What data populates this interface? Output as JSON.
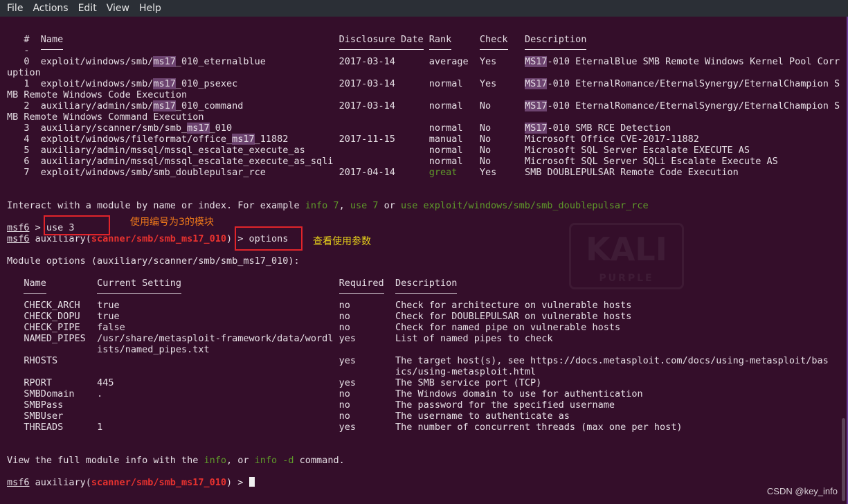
{
  "menu": [
    "File",
    "Actions",
    "Edit",
    "View",
    "Help"
  ],
  "modules": {
    "headers": {
      "num": "#",
      "name": "Name",
      "date": "Disclosure Date",
      "rank": "Rank",
      "check": "Check",
      "desc": "Description"
    },
    "rows": [
      {
        "num": "0",
        "name": "exploit/windows/smb/ms17_010_eternalblue",
        "date": "2017-03-14",
        "rank": "average",
        "check": "Yes",
        "desc": "MS17-010 EternalBlue SMB Remote Windows Kernel Pool Corruption"
      },
      {
        "num": "1",
        "name": "exploit/windows/smb/ms17_010_psexec",
        "date": "2017-03-14",
        "rank": "normal",
        "check": "Yes",
        "desc": "MS17-010 EternalRomance/EternalSynergy/EternalChampion SMB Remote Windows Code Execution"
      },
      {
        "num": "2",
        "name": "auxiliary/admin/smb/ms17_010_command",
        "date": "2017-03-14",
        "rank": "normal",
        "check": "No",
        "desc": "MS17-010 EternalRomance/EternalSynergy/EternalChampion SMB Remote Windows Command Execution"
      },
      {
        "num": "3",
        "name": "auxiliary/scanner/smb/smb_ms17_010",
        "date": "",
        "rank": "normal",
        "check": "No",
        "desc": "MS17-010 SMB RCE Detection"
      },
      {
        "num": "4",
        "name": "exploit/windows/fileformat/office_ms17_11882",
        "date": "2017-11-15",
        "rank": "manual",
        "check": "No",
        "desc": "Microsoft Office CVE-2017-11882"
      },
      {
        "num": "5",
        "name": "auxiliary/admin/mssql/mssql_escalate_execute_as",
        "date": "",
        "rank": "normal",
        "check": "No",
        "desc": "Microsoft SQL Server Escalate EXECUTE AS"
      },
      {
        "num": "6",
        "name": "auxiliary/admin/mssql/mssql_escalate_execute_as_sqli",
        "date": "",
        "rank": "normal",
        "check": "No",
        "desc": "Microsoft SQL Server SQLi Escalate Execute AS"
      },
      {
        "num": "7",
        "name": "exploit/windows/smb/smb_doublepulsar_rce",
        "date": "2017-04-14",
        "rank": "great",
        "check": "Yes",
        "desc": "SMB DOUBLEPULSAR Remote Code Execution"
      }
    ]
  },
  "interact": {
    "text1": "Interact with a module by name or index. For example ",
    "cmd1": "info 7",
    "sep1": ", ",
    "cmd2": "use 7",
    "sep2": " or ",
    "cmd3": "use exploit/windows/smb/smb_doublepulsar_rce"
  },
  "prompt1": {
    "msf": "msf6",
    "rest": " > ",
    "cmd": "use 3"
  },
  "prompt2": {
    "msf": "msf6",
    "pre": " auxiliary(",
    "module": "scanner/smb/smb_ms17_010",
    "post": ") > ",
    "cmd": "options"
  },
  "annotations": [
    {
      "text": "使用编号为3的模块",
      "color": "#f07a1a"
    },
    {
      "text": "查看使用参数",
      "color": "#e8d21a"
    }
  ],
  "options_title": "Module options (auxiliary/scanner/smb/smb_ms17_010):",
  "options": {
    "headers": {
      "name": "Name",
      "setting": "Current Setting",
      "required": "Required",
      "desc": "Description"
    },
    "rows": [
      {
        "name": "CHECK_ARCH",
        "setting": [
          "true"
        ],
        "required": "no",
        "desc": [
          "Check for architecture on vulnerable hosts"
        ]
      },
      {
        "name": "CHECK_DOPU",
        "setting": [
          "true"
        ],
        "required": "no",
        "desc": [
          "Check for DOUBLEPULSAR on vulnerable hosts"
        ]
      },
      {
        "name": "CHECK_PIPE",
        "setting": [
          "false"
        ],
        "required": "no",
        "desc": [
          "Check for named pipe on vulnerable hosts"
        ]
      },
      {
        "name": "NAMED_PIPES",
        "setting": [
          "/usr/share/metasploit-framework/data/wordl",
          "ists/named_pipes.txt"
        ],
        "required": "yes",
        "desc": [
          "List of named pipes to check"
        ]
      },
      {
        "name": "RHOSTS",
        "setting": [
          ""
        ],
        "required": "yes",
        "desc": [
          "The target host(s), see https://docs.metasploit.com/docs/using-metasploit/bas",
          "ics/using-metasploit.html"
        ]
      },
      {
        "name": "RPORT",
        "setting": [
          "445"
        ],
        "required": "yes",
        "desc": [
          "The SMB service port (TCP)"
        ]
      },
      {
        "name": "SMBDomain",
        "setting": [
          "."
        ],
        "required": "no",
        "desc": [
          "The Windows domain to use for authentication"
        ]
      },
      {
        "name": "SMBPass",
        "setting": [
          ""
        ],
        "required": "no",
        "desc": [
          "The password for the specified username"
        ]
      },
      {
        "name": "SMBUser",
        "setting": [
          ""
        ],
        "required": "no",
        "desc": [
          "The username to authenticate as"
        ]
      },
      {
        "name": "THREADS",
        "setting": [
          "1"
        ],
        "required": "yes",
        "desc": [
          "The number of concurrent threads (max one per host)"
        ]
      }
    ]
  },
  "view": {
    "t1": "View the full module info with the ",
    "c1": "info",
    "t2": ", or ",
    "c2": "info -d",
    "t3": " command."
  },
  "prompt3": {
    "msf": "msf6",
    "pre": " auxiliary(",
    "module": "scanner/smb/smb_ms17_010",
    "post": ") > "
  },
  "watermark": {
    "logo": "KALI",
    "sub": "PURPLE"
  },
  "csdn": "CSDN @key_info",
  "colors": {
    "background": "#340e2a",
    "highlight": "#6d4470",
    "green": "#5f9a2a",
    "red": "#e8322f",
    "box": "#e0242a"
  }
}
